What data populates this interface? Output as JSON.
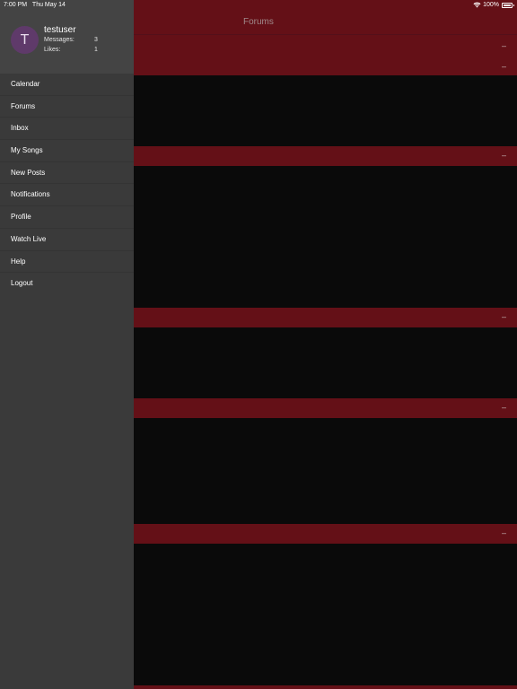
{
  "status": {
    "time": "7:00 PM",
    "date": "Thu May 14",
    "battery": "100%",
    "icons": [
      "wifi-icon",
      "battery-icon"
    ]
  },
  "header": {
    "title": "Forums",
    "collapse_glyph": "–"
  },
  "profile": {
    "avatar_letter": "T",
    "username": "testuser",
    "messages_label": "Messages:",
    "messages_count": "3",
    "likes_label": "Likes:",
    "likes_count": "1"
  },
  "menu": {
    "items": [
      {
        "label": "Calendar"
      },
      {
        "label": "Forums"
      },
      {
        "label": "Inbox"
      },
      {
        "label": "My Songs"
      },
      {
        "label": "New Posts"
      },
      {
        "label": "Notifications"
      },
      {
        "label": "Profile"
      },
      {
        "label": "Watch Live"
      },
      {
        "label": "Help"
      },
      {
        "label": "Logout"
      }
    ]
  },
  "colors": {
    "accent": "#641017",
    "drawer": "#3a3a3a",
    "profile_bg": "#444444",
    "content_bg": "#0a0a0a",
    "avatar": "#5f3a6a"
  }
}
